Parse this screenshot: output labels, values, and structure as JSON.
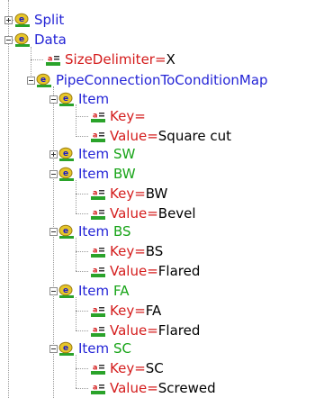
{
  "nodes": [
    {
      "label": "Split"
    },
    {
      "label": "Data"
    },
    {
      "label": "SizeDelimiter",
      "eq": " = ",
      "value": "X"
    },
    {
      "label": "PipeConnectionToConditionMap"
    },
    {
      "label": "Item",
      "value": ""
    },
    {
      "label": "Key",
      "eq": " = ",
      "value": ""
    },
    {
      "label": "Value",
      "eq": " = ",
      "value": "Square cut"
    },
    {
      "label": "Item",
      "value": "SW"
    },
    {
      "label": "Item",
      "value": "BW"
    },
    {
      "label": "Key",
      "eq": " = ",
      "value": "BW"
    },
    {
      "label": "Value",
      "eq": " = ",
      "value": "Bevel"
    },
    {
      "label": "Item",
      "value": "BS"
    },
    {
      "label": "Key",
      "eq": " = ",
      "value": "BS"
    },
    {
      "label": "Value",
      "eq": " = ",
      "value": "Flared"
    },
    {
      "label": "Item",
      "value": "FA"
    },
    {
      "label": "Key",
      "eq": " = ",
      "value": "FA"
    },
    {
      "label": "Value",
      "eq": " = ",
      "value": "Flared"
    },
    {
      "label": "Item",
      "value": "SC"
    },
    {
      "label": "Key",
      "eq": " = ",
      "value": "SC"
    },
    {
      "label": "Value",
      "eq": " = ",
      "value": "Screwed"
    }
  ],
  "icons": {
    "element": "xml-element-icon",
    "attribute": "xml-attribute-icon"
  },
  "colors": {
    "element_name": "#2424d6",
    "attribute_name": "#d41c1c",
    "element_value": "#18a418",
    "attribute_value": "#000000",
    "tree_lines": "#9a9a9a"
  }
}
